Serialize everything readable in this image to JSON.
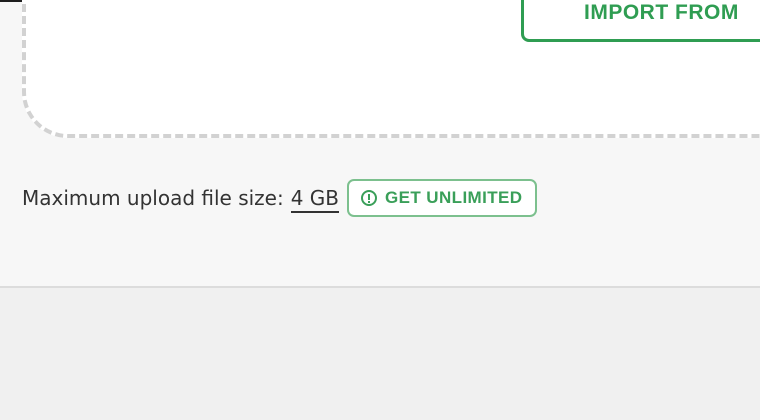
{
  "dropzone": {
    "import_button_label": "IMPORT FROM"
  },
  "upload_limit": {
    "label": "Maximum upload file size:",
    "value": "4 GB",
    "upgrade_button_label": "GET UNLIMITED",
    "upgrade_icon": "info-circle-icon"
  },
  "colors": {
    "accent_green": "#2f9d52",
    "upgrade_border": "#7cc08e",
    "dropzone_dash": "#d2d2d2"
  }
}
